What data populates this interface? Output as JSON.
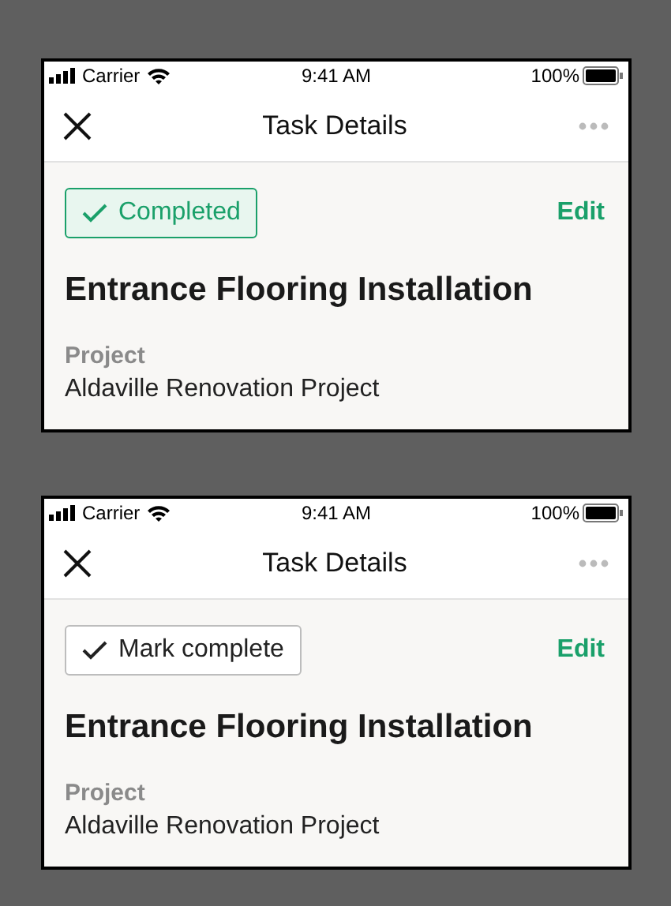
{
  "screens": [
    {
      "status_bar": {
        "carrier": "Carrier",
        "time": "9:41 AM",
        "battery": "100%"
      },
      "header": {
        "title": "Task Details"
      },
      "complete_button": {
        "label": "Completed",
        "completed": true
      },
      "edit_link": "Edit",
      "task_title": "Entrance Flooring Installation",
      "field": {
        "label": "Project",
        "value": "Aldaville Renovation Project"
      }
    },
    {
      "status_bar": {
        "carrier": "Carrier",
        "time": "9:41 AM",
        "battery": "100%"
      },
      "header": {
        "title": "Task Details"
      },
      "complete_button": {
        "label": "Mark complete",
        "completed": false
      },
      "edit_link": "Edit",
      "task_title": "Entrance Flooring Installation",
      "field": {
        "label": "Project",
        "value": "Aldaville Renovation Project"
      }
    }
  ]
}
